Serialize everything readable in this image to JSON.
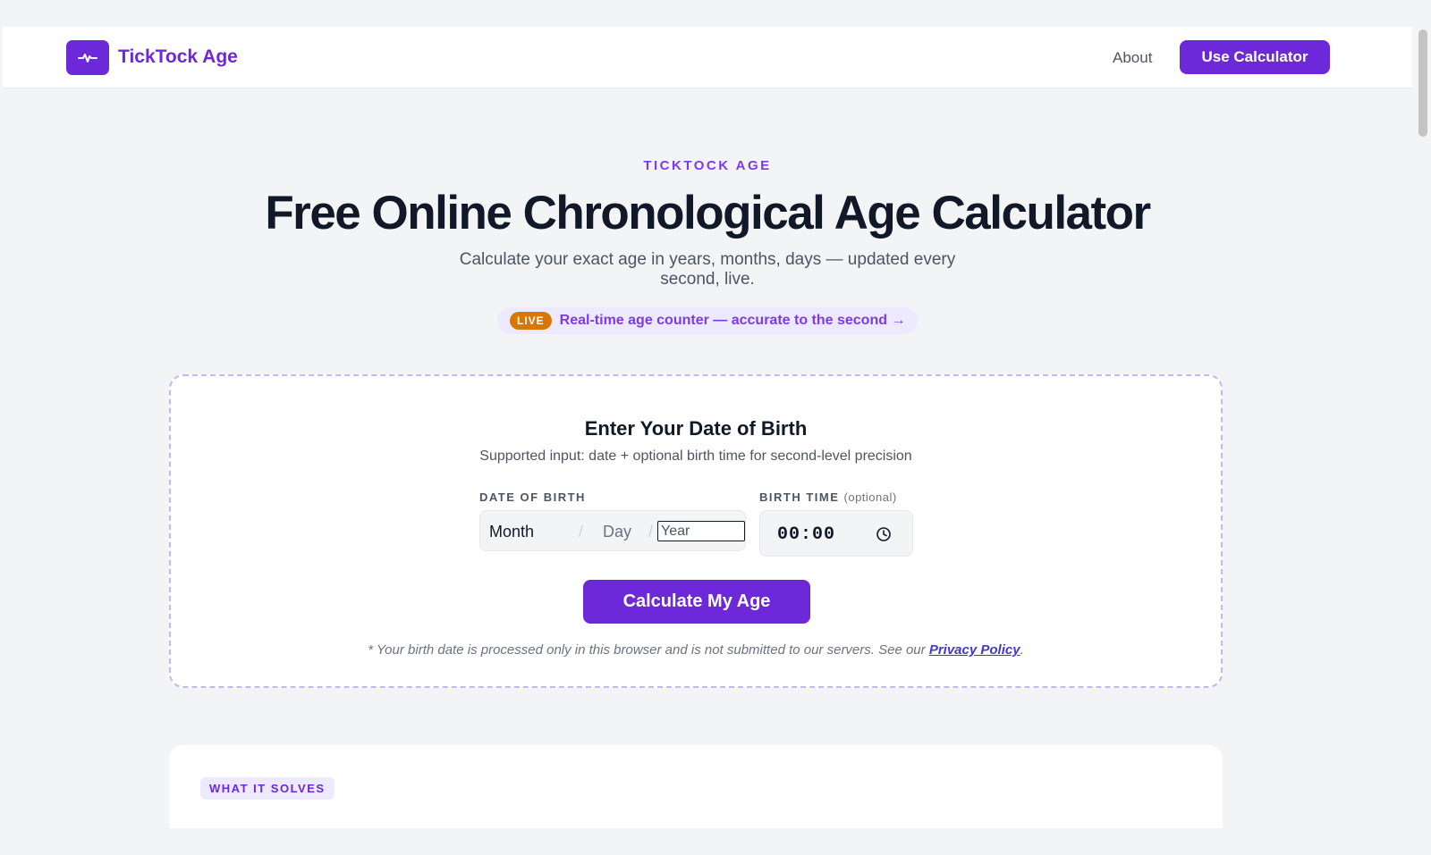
{
  "header": {
    "brand": "TickTock Age",
    "logo_icon": "pulse-icon",
    "nav_about": "About",
    "cta_label": "Use Calculator"
  },
  "hero": {
    "eyebrow": "TICKTOCK AGE",
    "title": "Free Online Chronological Age Calculator",
    "subtitle": "Calculate your exact age in years, months, days — updated every second, live.",
    "live_badge": "LIVE",
    "live_text": "Real-time age counter — accurate to the second →"
  },
  "calculator": {
    "title": "Enter Your Date of Birth",
    "subtitle": "Supported input: date + optional birth time for second-level precision",
    "dob_label": "DATE OF BIRTH",
    "month_placeholder": "Month",
    "separator": "/",
    "day_placeholder": "Day",
    "year_placeholder": "Year",
    "time_label": "BIRTH TIME",
    "time_optional": "(optional)",
    "time_value": "00:00",
    "time_icon": "clock-icon",
    "button_label": "Calculate My Age",
    "privacy_text": "* Your birth date is processed only in this browser and is not submitted to our servers. See our ",
    "privacy_link": "Privacy Policy",
    "privacy_end": "."
  },
  "section2": {
    "chip": "WHAT IT SOLVES"
  },
  "colors": {
    "accent": "#6d28d9",
    "accent_light": "#ede9fe",
    "live_badge": "#d97706",
    "background": "#f3f4f6"
  }
}
